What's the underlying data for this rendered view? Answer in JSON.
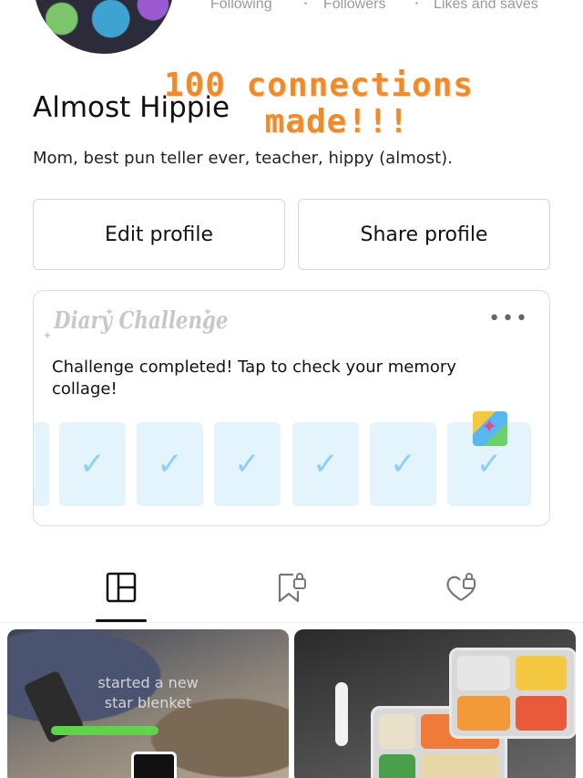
{
  "profile": {
    "name": "Almost Hippie",
    "bio": "Mom, best pun teller ever, teacher, hippy (almost).",
    "overlay_line1": "100 connections",
    "overlay_line2": "made!!!"
  },
  "stats": {
    "following_label": "Following",
    "followers_label": "Followers",
    "likes_label": "Likes and saves"
  },
  "buttons": {
    "edit_profile": "Edit profile",
    "share_profile": "Share profile"
  },
  "diary": {
    "title": "Diary Challenge",
    "message": "Challenge completed! Tap to check your memory collage!",
    "more": "•••",
    "check": "✓",
    "tiles": [
      "✓",
      "✓",
      "✓",
      "✓",
      "✓",
      "✓"
    ]
  },
  "tabs": [
    {
      "name": "posts",
      "icon": "grid-icon",
      "active": true
    },
    {
      "name": "collections",
      "icon": "bookmark-lock-icon",
      "active": false
    },
    {
      "name": "liked",
      "icon": "heart-lock-icon",
      "active": false
    }
  ],
  "posts": [
    {
      "caption_line1": "started a new",
      "caption_line2": "star blenket"
    }
  ],
  "colors": {
    "overlay_orange": "#f08a2c",
    "tile_bg": "#e4f4fc",
    "check_blue": "#8dd0f0"
  }
}
